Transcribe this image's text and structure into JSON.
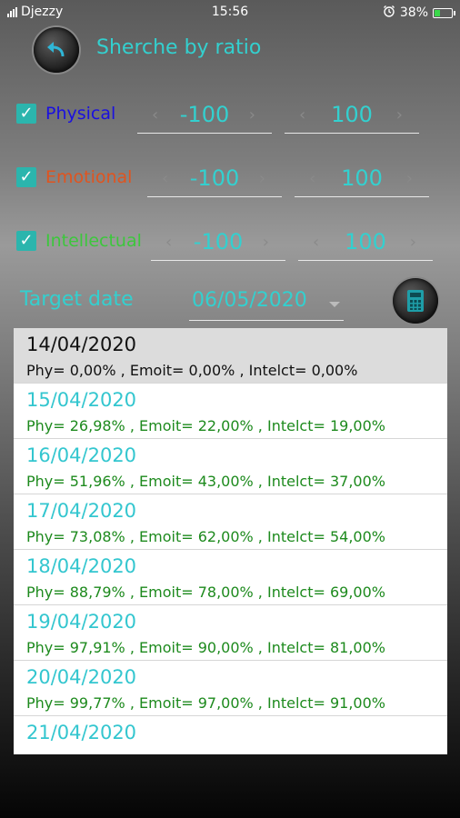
{
  "status": {
    "carrier": "Djezzy",
    "time": "15:56",
    "battery": "38%",
    "battery_level": 0.38
  },
  "header": {
    "title": "Sherche by ratio"
  },
  "filters": [
    {
      "label": "Physical",
      "checked": true,
      "color": "#1a10e0",
      "min": "-100",
      "max": "100"
    },
    {
      "label": "Emotional",
      "checked": true,
      "color": "#e0541f",
      "min": "-100",
      "max": "100"
    },
    {
      "label": "Intellectual",
      "checked": true,
      "color": "#3cc73c",
      "min": "-100",
      "max": "100"
    }
  ],
  "target": {
    "label": "Target date",
    "value": "06/05/2020"
  },
  "results": [
    {
      "date": "14/04/2020",
      "values": "Phy= 0,00% , Emoit= 0,00% , Intelct= 0,00%"
    },
    {
      "date": "15/04/2020",
      "values": "Phy= 26,98% , Emoit= 22,00% , Intelct= 19,00%"
    },
    {
      "date": "16/04/2020",
      "values": "Phy= 51,96% , Emoit= 43,00% , Intelct= 37,00%"
    },
    {
      "date": "17/04/2020",
      "values": "Phy= 73,08% , Emoit= 62,00% , Intelct= 54,00%"
    },
    {
      "date": "18/04/2020",
      "values": "Phy= 88,79% , Emoit= 78,00% , Intelct= 69,00%"
    },
    {
      "date": "19/04/2020",
      "values": "Phy= 97,91% , Emoit= 90,00% , Intelct= 81,00%"
    },
    {
      "date": "20/04/2020",
      "values": "Phy= 99,77% , Emoit= 97,00% , Intelct= 91,00%"
    },
    {
      "date": "21/04/2020",
      "values": ""
    }
  ],
  "colors": {
    "accent": "#33d0cf",
    "values_green": "#1d8a1d"
  },
  "icons": {
    "back": "back-arrow-icon",
    "calc": "calculator-icon",
    "alarm": "alarm-icon",
    "signal": "signal-icon",
    "battery": "battery-icon"
  }
}
